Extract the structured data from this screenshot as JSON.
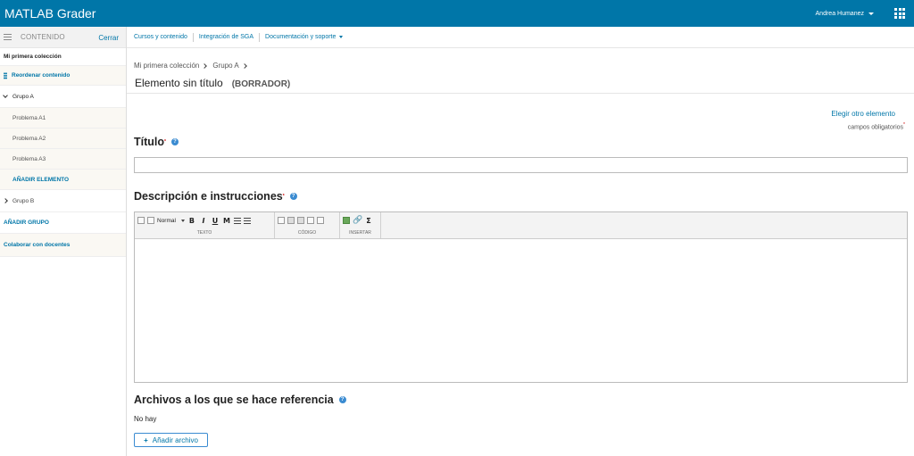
{
  "app": {
    "title": "MATLAB Grader"
  },
  "user": {
    "name": "Andrea Humanez"
  },
  "sidebar": {
    "header": "CONTENIDO",
    "close": "Cerrar",
    "collection": "Mi primera colección",
    "reorder": "Reordenar contenido",
    "groupA": "Grupo A",
    "problems": [
      "Problema A1",
      "Problema A2",
      "Problema A3"
    ],
    "add_item": "AÑADIR ELEMENTO",
    "groupB": "Grupo B",
    "add_group": "AÑADIR GRUPO",
    "collaborate": "Colaborar con docentes"
  },
  "subnav": {
    "items": [
      "Cursos y contenido",
      "Integración de SGA",
      "Documentación y soporte"
    ]
  },
  "breadcrumb": [
    "Mi primera colección",
    "Grupo A"
  ],
  "item": {
    "title": "Elemento sin título",
    "status": "(BORRADOR)"
  },
  "form": {
    "choose_other": "Elegir otro elemento",
    "required_note": "campos obligatorios",
    "required_mark": "*",
    "title_label": "Título",
    "description_label": "Descripción e instrucciones",
    "files_label": "Archivos a los que se hace referencia",
    "no_files": "No hay",
    "add_file": "Añadir archivo"
  },
  "editor": {
    "style_value": "Normal",
    "groups": [
      "TEXTO",
      "CÓDIGO",
      "INSERTAR"
    ]
  },
  "colors": {
    "brand": "#0076a8",
    "help": "#3a8bd1"
  }
}
